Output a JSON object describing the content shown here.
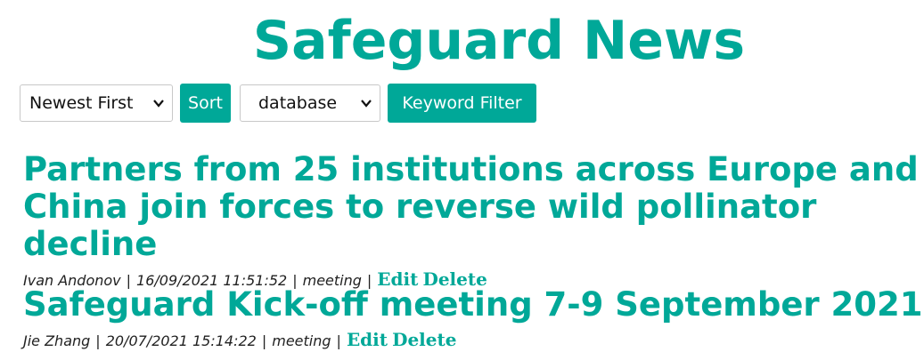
{
  "header": {
    "title": "Safeguard News"
  },
  "controls": {
    "order_select_value": "Newest First",
    "sort_label": "Sort",
    "keyword_select_value": "database",
    "filter_label": "Keyword Filter"
  },
  "articles": [
    {
      "title": "Partners from 25 institutions across Europe and China join forces to reverse wild pollinator decline",
      "author": "Ivan Andonov",
      "date": "16/09/2021 11:51:52",
      "tag": "meeting",
      "edit_label": "Edit",
      "delete_label": "Delete"
    },
    {
      "title": "Safeguard Kick-off meeting 7-9 September 2021",
      "author": "Jie Zhang",
      "date": "20/07/2021 15:14:22",
      "tag": "meeting",
      "edit_label": "Edit",
      "delete_label": "Delete"
    }
  ],
  "separator": "|",
  "colors": {
    "accent": "#00a898"
  },
  "icons": {
    "select_arrow": "chevron-down-icon"
  }
}
